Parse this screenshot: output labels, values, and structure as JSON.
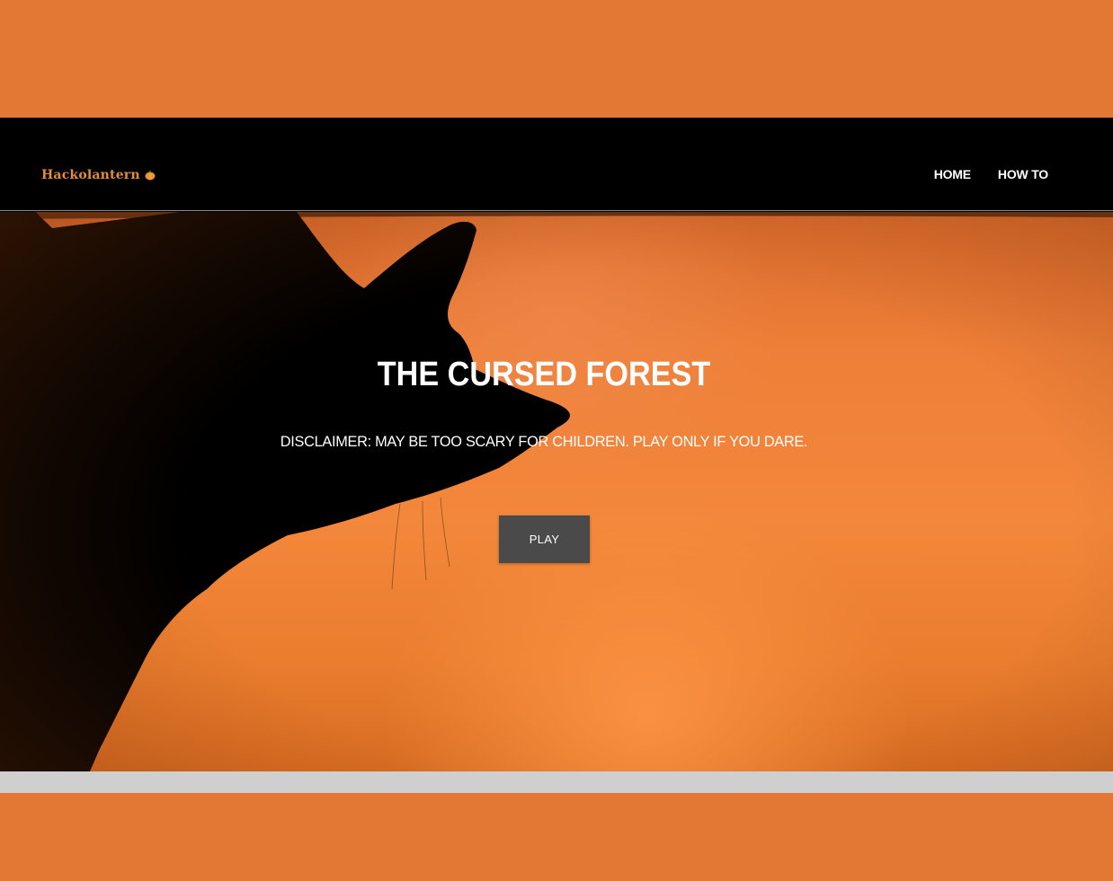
{
  "navbar": {
    "brand": "Hackolantern",
    "brand_icon": "pumpkin-icon",
    "links": [
      "HOME",
      "HOW TO"
    ]
  },
  "hero": {
    "title": "THE CURSED FOREST",
    "disclaimer": "DISCLAIMER: MAY BE TOO SCARY FOR CHILDREN. PLAY ONLY IF YOU DARE.",
    "play_label": "PLAY",
    "background_image": "cat-silhouette-against-orange-sky"
  },
  "colors": {
    "outer_background": "#e27834",
    "navbar_background": "#000000",
    "brand_color": "#e68a3c",
    "play_button_background": "#4a4a4a",
    "hero_orange": "#f3873b"
  }
}
